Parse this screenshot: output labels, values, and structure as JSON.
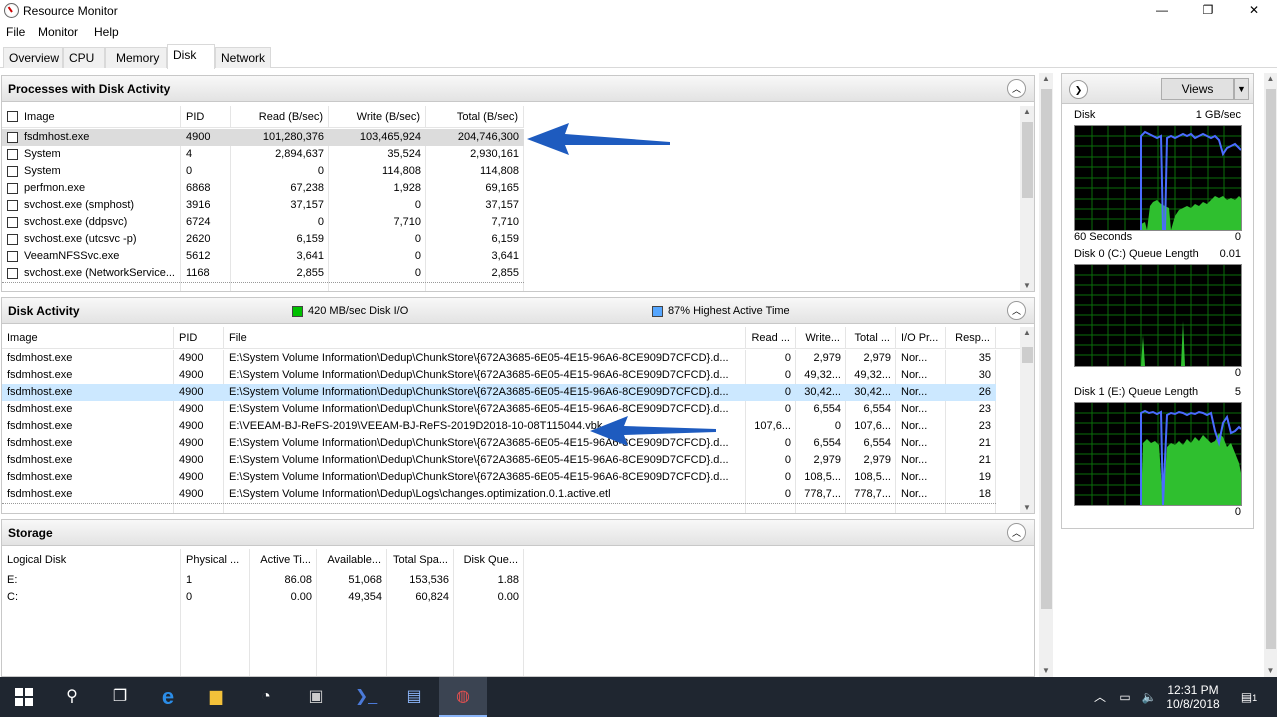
{
  "window": {
    "title": "Resource Monitor",
    "minimize": "—",
    "maximize": "❐",
    "close": "✕"
  },
  "menu": [
    "File",
    "Monitor",
    "Help"
  ],
  "tabs": [
    "Overview",
    "CPU",
    "Memory",
    "Disk",
    "Network"
  ],
  "processes": {
    "title": "Processes with Disk Activity",
    "columns": [
      "Image",
      "PID",
      "Read (B/sec)",
      "Write (B/sec)",
      "Total (B/sec)"
    ],
    "rows": [
      [
        "fsdmhost.exe",
        "4900",
        "101,280,376",
        "103,465,924",
        "204,746,300"
      ],
      [
        "System",
        "4",
        "2,894,637",
        "35,524",
        "2,930,161"
      ],
      [
        "System",
        "0",
        "0",
        "114,808",
        "114,808"
      ],
      [
        "perfmon.exe",
        "6868",
        "67,238",
        "1,928",
        "69,165"
      ],
      [
        "svchost.exe (smphost)",
        "3916",
        "37,157",
        "0",
        "37,157"
      ],
      [
        "svchost.exe (ddpsvc)",
        "6724",
        "0",
        "7,710",
        "7,710"
      ],
      [
        "svchost.exe (utcsvc -p)",
        "2620",
        "6,159",
        "0",
        "6,159"
      ],
      [
        "VeeamNFSSvc.exe",
        "5612",
        "3,641",
        "0",
        "3,641"
      ],
      [
        "svchost.exe (NetworkService...",
        "1168",
        "2,855",
        "0",
        "2,855"
      ]
    ]
  },
  "disk_activity": {
    "title": "Disk Activity",
    "io_label": "420 MB/sec Disk I/O",
    "active_label": "87% Highest Active Time",
    "io_color": "#00c000",
    "active_color": "#55a6ff",
    "columns": [
      "Image",
      "PID",
      "File",
      "Read ...",
      "Write...",
      "Total ...",
      "I/O Pr...",
      "Resp..."
    ],
    "rows": [
      [
        "fsdmhost.exe",
        "4900",
        "E:\\System Volume Information\\Dedup\\ChunkStore\\{672A3685-6E05-4E15-96A6-8CE909D7CFCD}.d...",
        "0",
        "2,979",
        "2,979",
        "Nor...",
        "35"
      ],
      [
        "fsdmhost.exe",
        "4900",
        "E:\\System Volume Information\\Dedup\\ChunkStore\\{672A3685-6E05-4E15-96A6-8CE909D7CFCD}.d...",
        "0",
        "49,32...",
        "49,32...",
        "Nor...",
        "30"
      ],
      [
        "fsdmhost.exe",
        "4900",
        "E:\\System Volume Information\\Dedup\\ChunkStore\\{672A3685-6E05-4E15-96A6-8CE909D7CFCD}.d...",
        "0",
        "30,42...",
        "30,42...",
        "Nor...",
        "26"
      ],
      [
        "fsdmhost.exe",
        "4900",
        "E:\\System Volume Information\\Dedup\\ChunkStore\\{672A3685-6E05-4E15-96A6-8CE909D7CFCD}.d...",
        "0",
        "6,554",
        "6,554",
        "Nor...",
        "23"
      ],
      [
        "fsdmhost.exe",
        "4900",
        "E:\\VEEAM-BJ-ReFS-2019\\VEEAM-BJ-ReFS-2019D2018-10-08T115044.vbk",
        "107,6...",
        "0",
        "107,6...",
        "Nor...",
        "23"
      ],
      [
        "fsdmhost.exe",
        "4900",
        "E:\\System Volume Information\\Dedup\\ChunkStore\\{672A3685-6E05-4E15-96A6-8CE909D7CFCD}.d...",
        "0",
        "6,554",
        "6,554",
        "Nor...",
        "21"
      ],
      [
        "fsdmhost.exe",
        "4900",
        "E:\\System Volume Information\\Dedup\\ChunkStore\\{672A3685-6E05-4E15-96A6-8CE909D7CFCD}.d...",
        "0",
        "2,979",
        "2,979",
        "Nor...",
        "21"
      ],
      [
        "fsdmhost.exe",
        "4900",
        "E:\\System Volume Information\\Dedup\\ChunkStore\\{672A3685-6E05-4E15-96A6-8CE909D7CFCD}.d...",
        "0",
        "108,5...",
        "108,5...",
        "Nor...",
        "19"
      ],
      [
        "fsdmhost.exe",
        "4900",
        "E:\\System Volume Information\\Dedup\\Logs\\changes.optimization.0.1.active.etl",
        "0",
        "778,7...",
        "778,7...",
        "Nor...",
        "18"
      ]
    ]
  },
  "storage": {
    "title": "Storage",
    "columns": [
      "Logical Disk",
      "Physical ...",
      "Active Ti...",
      "Available...",
      "Total Spa...",
      "Disk Que..."
    ],
    "rows": [
      [
        "E:",
        "1",
        "86.08",
        "51,068",
        "153,536",
        "1.88"
      ],
      [
        "C:",
        "0",
        "0.00",
        "49,354",
        "60,824",
        "0.00"
      ]
    ]
  },
  "graphs": {
    "views_label": "Views",
    "disk": {
      "label": "Disk",
      "max": "1 GB/sec",
      "bottom_left": "60 Seconds",
      "bottom_right": "0"
    },
    "disk0": {
      "label": "Disk 0 (C:) Queue Length",
      "max": "0.01",
      "bottom_right": "0"
    },
    "disk1": {
      "label": "Disk 1 (E:) Queue Length",
      "max": "5",
      "bottom_right": "0"
    }
  },
  "taskbar": {
    "time": "12:31 PM",
    "date": "10/8/2018",
    "notif_count": "1"
  }
}
